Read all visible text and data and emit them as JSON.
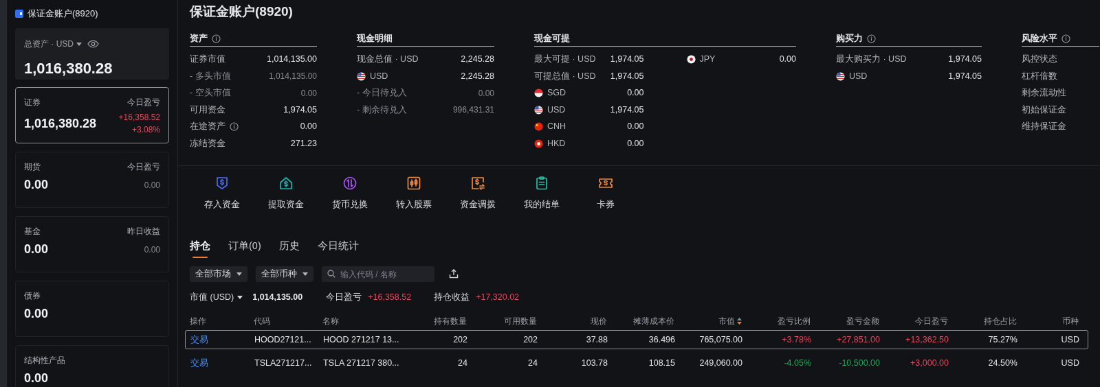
{
  "sidebar": {
    "title": "保证金账户(8920)",
    "total": {
      "label": "总资产 · USD",
      "value": "1,016,380.28"
    },
    "cards": [
      {
        "label": "证券",
        "right_label": "今日盈亏",
        "value": "1,016,380.28",
        "changes": [
          "+16,358.52",
          "+3.08%"
        ],
        "color": "#e5475c",
        "selected": true
      },
      {
        "label": "期货",
        "right_label": "今日盈亏",
        "value": "0.00",
        "changes": [
          "0.00"
        ],
        "color": "#8a8e95",
        "selected": false
      },
      {
        "label": "基金",
        "right_label": "昨日收益",
        "value": "0.00",
        "changes": [
          "0.00"
        ],
        "color": "#8a8e95",
        "selected": false
      },
      {
        "label": "债券",
        "value": "0.00",
        "selected": false
      },
      {
        "label": "结构性产品",
        "value": "0.00",
        "selected": false
      }
    ]
  },
  "title": "保证金账户(8920)",
  "sections": [
    {
      "title": "资产",
      "info": true,
      "columns": [
        [
          {
            "label": "证券市值",
            "value": "1,014,135.00",
            "kind": "main"
          },
          {
            "label": "- 多头市值",
            "value": "1,014,135.00",
            "kind": "sub"
          },
          {
            "label": "- 空头市值",
            "value": "0.00",
            "kind": "sub"
          },
          {
            "label": "可用资金",
            "value": "1,974.05",
            "kind": "main"
          },
          {
            "label": "在途资产",
            "value": "0.00",
            "kind": "main",
            "info": true
          },
          {
            "label": "冻结资金",
            "value": "271.23",
            "kind": "main"
          }
        ]
      ]
    },
    {
      "title": "现金明细",
      "columns": [
        [
          {
            "label": "现金总值 · USD",
            "value": "2,245.28",
            "kind": "main"
          },
          {
            "label": "USD",
            "value": "2,245.28",
            "kind": "us"
          },
          {
            "label": "- 今日待兑入",
            "value": "0.00",
            "kind": "sub"
          },
          {
            "label": "- 剩余待兑入",
            "value": "996,431.31",
            "kind": "sub"
          }
        ]
      ]
    },
    {
      "title": "现金可提",
      "columns": [
        [
          {
            "label": "最大可提 · USD",
            "value": "1,974.05",
            "kind": "main"
          },
          {
            "label": "可提总值 · USD",
            "value": "1,974.05",
            "kind": "main"
          },
          {
            "label": "SGD",
            "value": "0.00",
            "kind": "sg"
          },
          {
            "label": "USD",
            "value": "1,974.05",
            "kind": "us"
          },
          {
            "label": "CNH",
            "value": "0.00",
            "kind": "cn"
          },
          {
            "label": "HKD",
            "value": "0.00",
            "kind": "hk"
          }
        ],
        [
          {
            "label": "JPY",
            "value": "0.00",
            "kind": "jp"
          }
        ]
      ]
    },
    {
      "title": "购买力",
      "info": true,
      "columns": [
        [
          {
            "label": "最大购买力 · USD",
            "value": "1,974.05",
            "kind": "main"
          },
          {
            "label": "USD",
            "value": "1,974.05",
            "kind": "us"
          }
        ]
      ]
    },
    {
      "title": "风险水平",
      "info": true,
      "columns": [
        [
          {
            "label": "风控状态",
            "kind": "main"
          },
          {
            "label": "杠杆倍数",
            "kind": "main"
          },
          {
            "label": "剩余流动性",
            "kind": "main"
          },
          {
            "label": "初始保证金",
            "kind": "main"
          },
          {
            "label": "维持保证金",
            "kind": "main"
          }
        ]
      ]
    }
  ],
  "actions": [
    {
      "label": "存入资金",
      "kind": "deposit"
    },
    {
      "label": "提取资金",
      "kind": "withdraw"
    },
    {
      "label": "货币兑换",
      "kind": "exchange"
    },
    {
      "label": "转入股票",
      "kind": "transfer"
    },
    {
      "label": "资金调拨",
      "kind": "allocate"
    },
    {
      "label": "我的结单",
      "kind": "statement"
    },
    {
      "label": "卡券",
      "kind": "coupon"
    }
  ],
  "tabs": [
    {
      "label": "持仓",
      "selected": true
    },
    {
      "label": "订单(0)",
      "selected": false
    },
    {
      "label": "历史",
      "selected": false
    },
    {
      "label": "今日统计",
      "selected": false
    }
  ],
  "filters": [
    "全部市场",
    "全部币种"
  ],
  "search": {
    "placeholder": "输入代码 / 名称"
  },
  "summary": {
    "market_label": "市值 (USD)",
    "market_value": "1,014,135.00",
    "items": [
      {
        "label": "今日盈亏",
        "value": "+16,358.52"
      },
      {
        "label": "持仓收益",
        "value": "+17,320.02"
      }
    ]
  },
  "table": {
    "columns": [
      {
        "label": "操作"
      },
      {
        "label": "代码"
      },
      {
        "label": "名称"
      },
      {
        "label": "持有数量"
      },
      {
        "label": "可用数量"
      },
      {
        "label": "现价"
      },
      {
        "label": "摊薄成本价"
      },
      {
        "label": "市值",
        "sortable": true
      },
      {
        "label": "盈亏比例"
      },
      {
        "label": "盈亏金额"
      },
      {
        "label": "今日盈亏"
      },
      {
        "label": "持仓占比"
      },
      {
        "label": "币种"
      }
    ],
    "rows": [
      {
        "selected": true,
        "cells": [
          {
            "text": "交易"
          },
          {
            "text": "HOOD27121..."
          },
          {
            "text": "HOOD 271217 13..."
          },
          {
            "text": "202"
          },
          {
            "text": "202"
          },
          {
            "text": "37.88"
          },
          {
            "text": "36.496"
          },
          {
            "text": "765,075.00"
          },
          {
            "text": "+3.78%",
            "color": "#e5475c"
          },
          {
            "text": "+27,851.00",
            "color": "#e5475c"
          },
          {
            "text": "+13,362.50",
            "color": "#e5475c"
          },
          {
            "text": "75.27%"
          },
          {
            "text": "USD"
          }
        ]
      },
      {
        "selected": false,
        "cells": [
          {
            "text": "交易"
          },
          {
            "text": "TSLA271217..."
          },
          {
            "text": "TSLA 271217 380..."
          },
          {
            "text": "24"
          },
          {
            "text": "24"
          },
          {
            "text": "103.78"
          },
          {
            "text": "108.15"
          },
          {
            "text": "249,060.00"
          },
          {
            "text": "-4.05%",
            "color": "#22a55c"
          },
          {
            "text": "-10,500.00",
            "color": "#22a55c"
          },
          {
            "text": "+3,000.00",
            "color": "#e5475c"
          },
          {
            "text": "24.50%"
          },
          {
            "text": "USD"
          }
        ]
      }
    ]
  }
}
